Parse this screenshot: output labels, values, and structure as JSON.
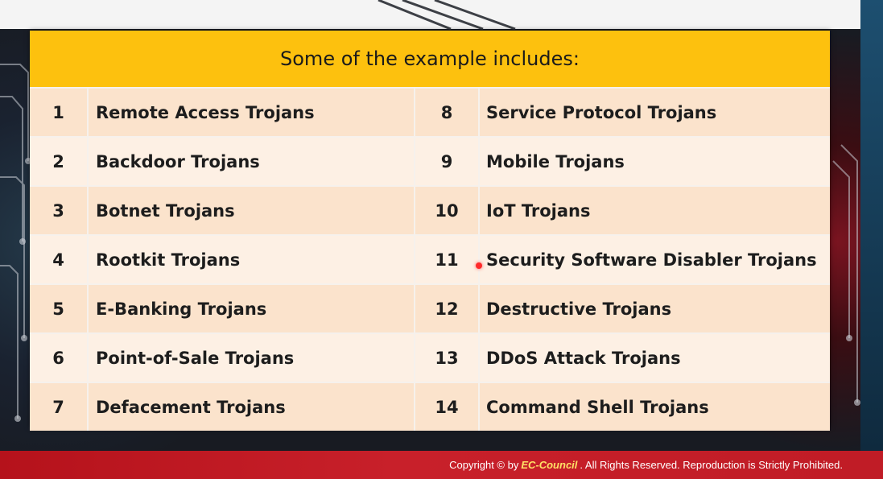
{
  "slide": {
    "header": "Some of the example includes:",
    "left_items": [
      {
        "num": "1",
        "name": "Remote Access Trojans"
      },
      {
        "num": "2",
        "name": "Backdoor Trojans"
      },
      {
        "num": "3",
        "name": "Botnet Trojans"
      },
      {
        "num": "4",
        "name": "Rootkit Trojans"
      },
      {
        "num": "5",
        "name": "E-Banking Trojans"
      },
      {
        "num": "6",
        "name": "Point-of-Sale Trojans"
      },
      {
        "num": "7",
        "name": "Defacement Trojans"
      }
    ],
    "right_items": [
      {
        "num": "8",
        "name": "Service Protocol Trojans"
      },
      {
        "num": "9",
        "name": "Mobile Trojans"
      },
      {
        "num": "10",
        "name": "IoT Trojans"
      },
      {
        "num": "11",
        "name": "Security Software Disabler Trojans"
      },
      {
        "num": "12",
        "name": "Destructive Trojans"
      },
      {
        "num": "13",
        "name": "DDoS Attack Trojans"
      },
      {
        "num": "14",
        "name": "Command Shell Trojans"
      }
    ]
  },
  "footer": {
    "prefix": "Copyright © by",
    "brand": "EC-Council",
    "suffix": ". All Rights Reserved. Reproduction is Strictly Prohibited."
  },
  "colors": {
    "header_bg": "#fdc10e",
    "row_bg": "#fbe3cc",
    "row_alt_bg": "#fdf0e4",
    "footer_bg": "#c8202a"
  }
}
